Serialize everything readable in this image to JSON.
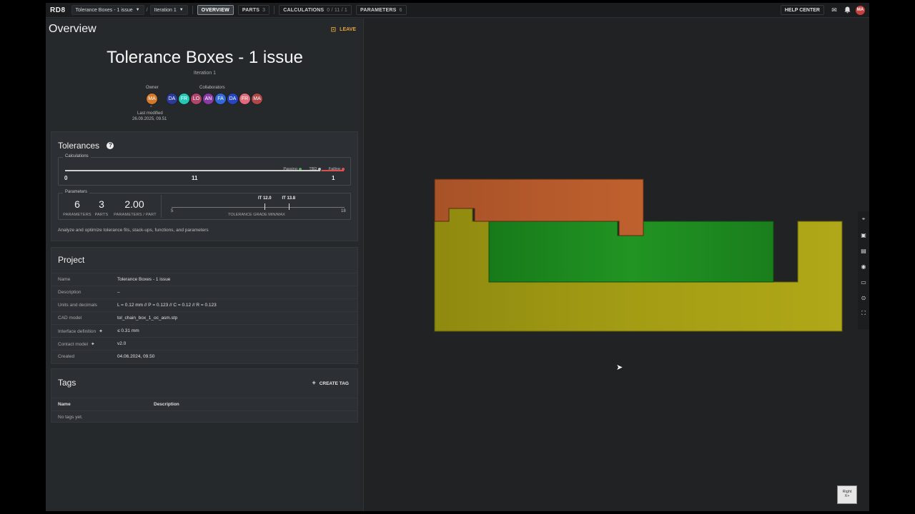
{
  "topbar": {
    "logo": "RD8",
    "project_crumb": "Tolerance Boxes - 1 issue",
    "iteration_crumb": "Iteration 1",
    "separator": "/",
    "tabs": [
      {
        "label": "OVERVIEW",
        "count": ""
      },
      {
        "label": "PARTS",
        "count": "3"
      },
      {
        "label": "CALCULATIONS",
        "count": "0 / 11 / 1"
      },
      {
        "label": "PARAMETERS",
        "count": "6"
      }
    ],
    "help_center": "HELP CENTER",
    "user_initials": "MA"
  },
  "overview": {
    "header": "Overview",
    "leave": "LEAVE",
    "title": "Tolerance Boxes - 1 issue",
    "iteration": "Iteration 1",
    "owner_label": "Owner",
    "collaborators_label": "Collaborators",
    "owner": {
      "initials": "MA",
      "color": "#d4782a"
    },
    "collaborators": [
      {
        "initials": "DA",
        "color": "#2b3a9a"
      },
      {
        "initials": "FR",
        "color": "#22c7b5"
      },
      {
        "initials": "LO",
        "color": "#b0446a"
      },
      {
        "initials": "AN",
        "color": "#8a3aa6"
      },
      {
        "initials": "FA",
        "color": "#2f6ad8"
      },
      {
        "initials": "DA",
        "color": "#2545c2"
      },
      {
        "initials": "FR",
        "color": "#e06a7a"
      },
      {
        "initials": "MA",
        "color": "#b04848"
      }
    ],
    "last_modified_label": "Last modified",
    "last_modified": "26.09.2025, 09.51"
  },
  "tolerances": {
    "title": "Tolerances",
    "calculations_label": "Calculations",
    "legend": [
      {
        "label": "Passing",
        "color": "#4caf50"
      },
      {
        "label": "TBD",
        "color": "#bbbbbb"
      },
      {
        "label": "Failing",
        "color": "#e05050"
      }
    ],
    "passing": "0",
    "tbd": "11",
    "failing": "1",
    "parameters_label": "Parameters",
    "params_count": "6",
    "params_count_label": "PARAMETERS",
    "parts_count": "3",
    "parts_label": "PARTS",
    "params_per_part": "2.00",
    "params_per_part_label": "PARAMETERS / PART",
    "grade_min_label": "IT 12.0",
    "grade_max_label": "IT 13.8",
    "grade_min": 12.0,
    "grade_max": 13.8,
    "scale_min": "5",
    "scale_max": "18",
    "grade_caption": "TOLERANCE GRADE MIN/MAX",
    "description": "Analyze and optimize tolerance fits, stack-ups, functions, and parameters"
  },
  "project": {
    "title": "Project",
    "rows": [
      {
        "key": "Name",
        "value": "Tolerance Boxes - 1 issue"
      },
      {
        "key": "Description",
        "value": "–"
      },
      {
        "key": "Units and decimals",
        "value": "L = 0.12 mm // P = 0.123 // C = 0.12 // R = 0.123"
      },
      {
        "key": "CAD model",
        "value": "tol_chain_box_1_oc_asm.stp"
      },
      {
        "key": "Interface definition",
        "value": "≤ 0.31 mm"
      },
      {
        "key": "Contact model",
        "value": "v2.0"
      },
      {
        "key": "Created",
        "value": "04.06.2024, 09.50"
      }
    ]
  },
  "tags": {
    "title": "Tags",
    "create_label": "CREATE TAG",
    "col_name": "Name",
    "col_description": "Description",
    "empty": "No tags yet."
  },
  "viewport": {
    "viewcube_label": "Right",
    "viewcube_sub": "X+"
  },
  "colors": {
    "part_top": "#b85c2c",
    "part_middle": "#1f8a22",
    "part_base": "#a8a214",
    "accent_leave": "#e0a33a"
  }
}
